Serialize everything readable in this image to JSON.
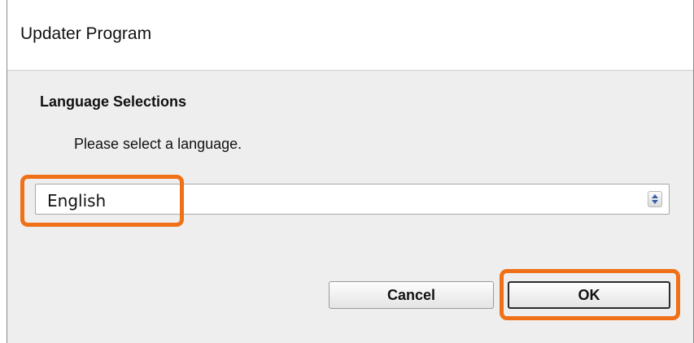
{
  "window": {
    "title": "Updater Program"
  },
  "dialog": {
    "heading": "Language Selections",
    "instruction": "Please select a language.",
    "language_select": {
      "selected": "English"
    },
    "buttons": {
      "cancel_label": "Cancel",
      "ok_label": "OK"
    }
  },
  "colors": {
    "highlight": "#f07018",
    "dialog_background": "#eeeeee"
  },
  "icons": {
    "select_arrows": "up-down-chevron-icon"
  }
}
